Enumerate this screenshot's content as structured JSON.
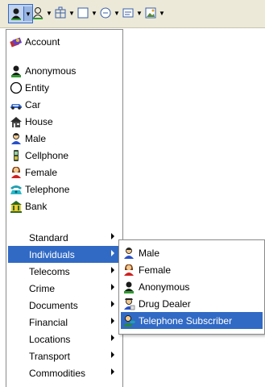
{
  "toolbar": {
    "buttons": [
      {
        "icon": "person-icon",
        "pressed": true
      },
      {
        "icon": "person-outline-icon",
        "pressed": false
      },
      {
        "icon": "building-icon",
        "pressed": false
      },
      {
        "icon": "rectangle-icon",
        "pressed": false
      },
      {
        "icon": "circle-icon",
        "pressed": false
      },
      {
        "icon": "document-icon",
        "pressed": false
      },
      {
        "icon": "image-icon",
        "pressed": false
      }
    ]
  },
  "menu": {
    "entities": [
      {
        "label": "Account",
        "icon": "account-icon"
      },
      {
        "label": "Anonymous",
        "icon": "anonymous-person-icon"
      },
      {
        "label": "Entity",
        "icon": "entity-circle-icon"
      },
      {
        "label": "Car",
        "icon": "car-icon"
      },
      {
        "label": "House",
        "icon": "house-icon"
      },
      {
        "label": "Male",
        "icon": "male-person-icon"
      },
      {
        "label": "Cellphone",
        "icon": "cellphone-icon"
      },
      {
        "label": "Female",
        "icon": "female-person-icon"
      },
      {
        "label": "Telephone",
        "icon": "telephone-icon"
      },
      {
        "label": "Bank",
        "icon": "bank-icon"
      }
    ],
    "categories": [
      {
        "label": "Standard"
      },
      {
        "label": "Individuals",
        "selected": true
      },
      {
        "label": "Telecoms"
      },
      {
        "label": "Crime"
      },
      {
        "label": "Documents"
      },
      {
        "label": "Financial"
      },
      {
        "label": "Locations"
      },
      {
        "label": "Transport"
      },
      {
        "label": "Commodities"
      }
    ]
  },
  "submenu": {
    "items": [
      {
        "label": "Male",
        "icon": "male-person-icon"
      },
      {
        "label": "Female",
        "icon": "female-person-icon"
      },
      {
        "label": "Anonymous",
        "icon": "anonymous-person-icon"
      },
      {
        "label": "Drug Dealer",
        "icon": "drug-dealer-icon"
      },
      {
        "label": "Telephone Subscriber",
        "icon": "telephone-subscriber-icon",
        "selected": true
      }
    ]
  },
  "colors": {
    "highlight": "#316ac5",
    "toolbar_bg": "#ece9d8"
  }
}
